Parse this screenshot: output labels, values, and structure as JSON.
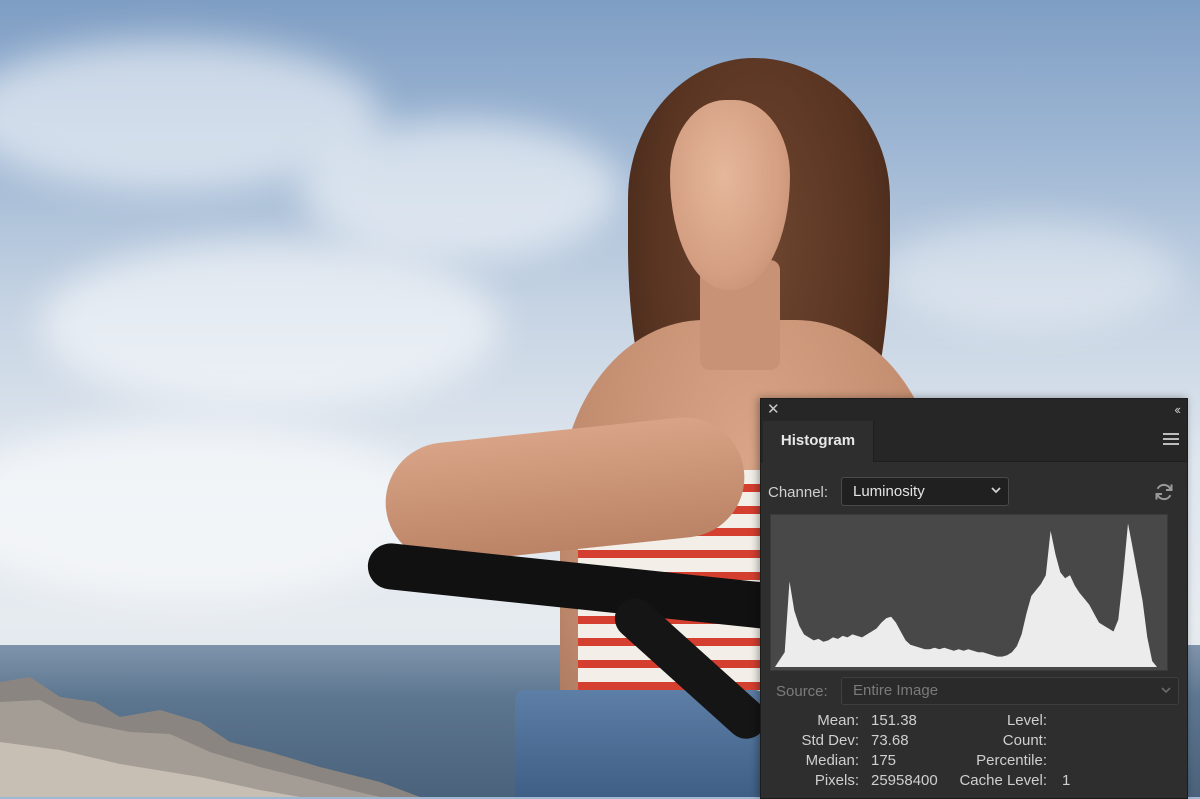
{
  "panel": {
    "close_glyph": "✕",
    "collapse_glyph": "‹‹",
    "tab_label": "Histogram",
    "menu_icon": "hamburger-icon",
    "channel": {
      "label": "Channel:",
      "value": "Luminosity"
    },
    "refresh_icon": "refresh-icon",
    "source": {
      "label": "Source:",
      "value": "Entire Image"
    },
    "stats_left": [
      {
        "label": "Mean:",
        "value": "151.38"
      },
      {
        "label": "Std Dev:",
        "value": "73.68"
      },
      {
        "label": "Median:",
        "value": "175"
      },
      {
        "label": "Pixels:",
        "value": "25958400"
      }
    ],
    "stats_right": [
      {
        "label": "Level:",
        "value": ""
      },
      {
        "label": "Count:",
        "value": ""
      },
      {
        "label": "Percentile:",
        "value": ""
      },
      {
        "label": "Cache Level:",
        "value": "1"
      }
    ]
  },
  "histogram": {
    "fill_color": "#ececec",
    "background_color": "#484848",
    "levels": [
      0,
      0.05,
      0.1,
      0.58,
      0.38,
      0.28,
      0.22,
      0.2,
      0.18,
      0.19,
      0.17,
      0.18,
      0.2,
      0.19,
      0.21,
      0.2,
      0.22,
      0.21,
      0.2,
      0.22,
      0.24,
      0.26,
      0.3,
      0.33,
      0.34,
      0.3,
      0.24,
      0.18,
      0.15,
      0.14,
      0.13,
      0.12,
      0.12,
      0.13,
      0.12,
      0.13,
      0.12,
      0.11,
      0.12,
      0.11,
      0.12,
      0.11,
      0.1,
      0.1,
      0.09,
      0.08,
      0.07,
      0.07,
      0.08,
      0.1,
      0.14,
      0.22,
      0.36,
      0.48,
      0.52,
      0.56,
      0.62,
      0.92,
      0.76,
      0.64,
      0.6,
      0.62,
      0.55,
      0.5,
      0.46,
      0.42,
      0.36,
      0.3,
      0.28,
      0.26,
      0.24,
      0.32,
      0.62,
      0.97,
      0.8,
      0.62,
      0.45,
      0.2,
      0.04,
      0
    ]
  }
}
